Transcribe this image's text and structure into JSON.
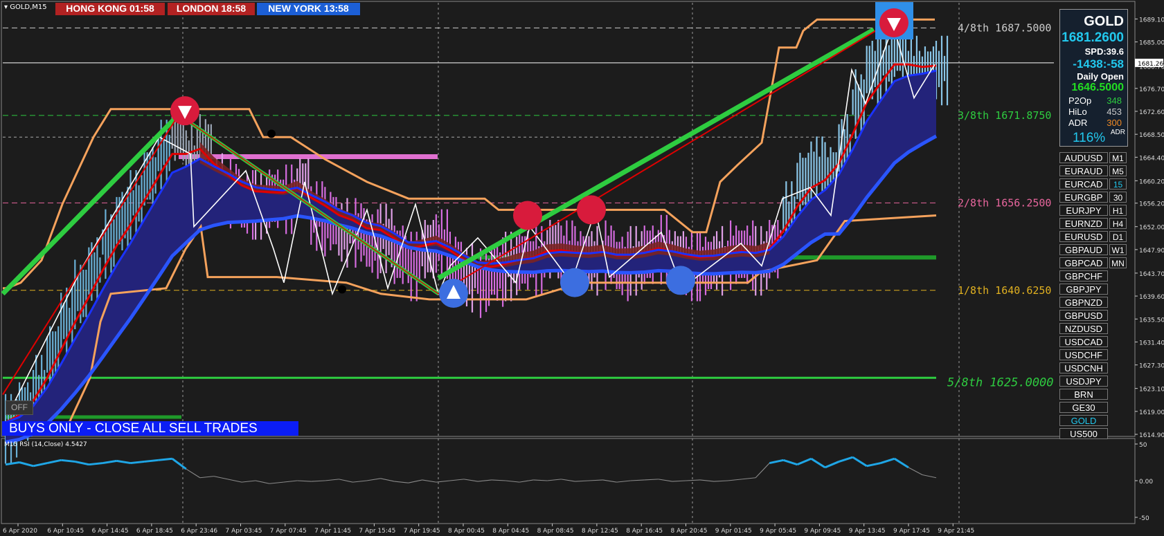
{
  "window": {
    "symbol_label": "GOLD,M15"
  },
  "sessions": [
    {
      "label": "HONG KONG 01:58",
      "bg": "#b22222"
    },
    {
      "label": "LONDON  18:58",
      "bg": "#b22222"
    },
    {
      "label": "NEW YORK  13:58",
      "bg": "#1c5fd6"
    }
  ],
  "colors": {
    "background": "#1c1c1c",
    "envelope": "#f5a25c",
    "ema_blue": "#1a33ff",
    "fill_navy": "#23237a",
    "zigzag": "#ffffff",
    "trend_green": "#2ecc40",
    "trend_red": "#e00000",
    "rsi_blue": "#1fa6e6"
  },
  "murrey_levels": [
    {
      "label": "4/8th",
      "price": "1687.5000",
      "color": "#cccccc"
    },
    {
      "label": "3/8th",
      "price": "1671.8750",
      "color": "#2ecc40"
    },
    {
      "label": "2/8th",
      "price": "1656.2500",
      "color": "#e8669d"
    },
    {
      "label": "1/8th",
      "price": "1640.6250",
      "color": "#e0b020"
    },
    {
      "label": "5/8th",
      "price": "1625.0000",
      "color": "#2ecc40"
    }
  ],
  "buys_banner": "BUYS ONLY - CLOSE ALL SELL TRADES",
  "off_button": "OFF",
  "info_panel": {
    "symbol": "GOLD",
    "price": "1681.2600",
    "spread": "SPD:39.6",
    "timer": "-1438:-58",
    "daily_open_label": "Daily Open",
    "daily_open": "1646.5000",
    "stats": [
      {
        "label": "P2Op",
        "value": "348",
        "color": "#2ecc40"
      },
      {
        "label": "HiLo",
        "value": "453",
        "color": "#cccccc"
      },
      {
        "label": "ADR",
        "value": "300",
        "color": "#f08a24"
      }
    ],
    "adr_pct": "116%",
    "adr_tag": "ADR"
  },
  "symbol_buttons": [
    "AUDUSD",
    "EURAUD",
    "EURCAD",
    "EURGBP",
    "EURJPY",
    "EURNZD",
    "EURUSD",
    "GBPAUD",
    "GBPCAD",
    "GBPCHF",
    "GBPJPY",
    "GBPNZD",
    "GBPUSD",
    "NZDUSD",
    "USDCAD",
    "USDCHF",
    "USDCNH",
    "USDJPY",
    "BRN",
    "GE30",
    "GOLD",
    "US500"
  ],
  "timeframe_buttons": [
    "M1",
    "M5",
    "15",
    "30",
    "H1",
    "H4",
    "D1",
    "W1",
    "MN"
  ],
  "rsi_label": "M15 RSI (14,Close) 4.5427",
  "chart_data": {
    "type": "candlestick",
    "price_axis": {
      "range": [
        1614.9,
        1691.5
      ],
      "ticks": [
        "1689.10",
        "1685.00",
        "1680.70",
        "1676.70",
        "1672.60",
        "1668.50",
        "1664.40",
        "1660.20",
        "1656.20",
        "1652.00",
        "1647.90",
        "1643.70",
        "1639.60",
        "1635.50",
        "1631.40",
        "1627.30",
        "1623.10",
        "1619.00",
        "1614.90"
      ],
      "current_price": "1681.26"
    },
    "time_axis": [
      "6 Apr 2020",
      "6 Apr 10:45",
      "6 Apr 14:45",
      "6 Apr 18:45",
      "6 Apr 23:46",
      "7 Apr 03:45",
      "7 Apr 07:45",
      "7 Apr 11:45",
      "7 Apr 15:45",
      "7 Apr 19:45",
      "8 Apr 00:45",
      "8 Apr 04:45",
      "8 Apr 08:45",
      "8 Apr 12:45",
      "8 Apr 16:45",
      "8 Apr 20:45",
      "9 Apr 01:45",
      "9 Apr 05:45",
      "9 Apr 09:45",
      "9 Apr 13:45",
      "9 Apr 17:45",
      "9 Apr 21:45"
    ],
    "close_series": [
      1617,
      1620,
      1624,
      1630,
      1636,
      1641,
      1645,
      1650,
      1654,
      1657,
      1662,
      1666,
      1670,
      1665,
      1667,
      1660,
      1659,
      1657,
      1657,
      1658,
      1658,
      1660,
      1655,
      1654,
      1652,
      1652,
      1650,
      1651,
      1648,
      1646,
      1649,
      1650,
      1646,
      1644,
      1643,
      1645,
      1646,
      1647,
      1647,
      1649,
      1648,
      1647,
      1647,
      1648,
      1646,
      1647,
      1648,
      1649,
      1647,
      1646,
      1646,
      1647,
      1648,
      1648,
      1647,
      1649,
      1655,
      1661,
      1663,
      1662,
      1667,
      1675,
      1681,
      1682,
      1685,
      1681,
      1680,
      1681
    ],
    "rsi": {
      "levels": [
        "50",
        "0.00",
        "-50"
      ],
      "value": "4.5427",
      "values": [
        22,
        25,
        20,
        24,
        28,
        26,
        22,
        24,
        27,
        24,
        26,
        28,
        30,
        16,
        4,
        6,
        2,
        -2,
        0,
        -4,
        -2,
        0,
        -1,
        0,
        2,
        -2,
        0,
        3,
        -1,
        -3,
        1,
        -2,
        0,
        2,
        -1,
        1,
        0,
        -2,
        1,
        0,
        2,
        -1,
        0,
        1,
        -2,
        0,
        1,
        2,
        -1,
        0,
        1,
        -1,
        0,
        2,
        4,
        24,
        28,
        22,
        30,
        18,
        26,
        32,
        20,
        24,
        30,
        18,
        8,
        4
      ]
    },
    "markers": [
      {
        "type": "sell-arrow",
        "price": 1672.7
      },
      {
        "type": "buy-arrow",
        "price": 1640.1
      },
      {
        "type": "sell-dot",
        "price": 1654.0
      },
      {
        "type": "sell-dot",
        "price": 1655.0
      },
      {
        "type": "buy-dot",
        "price": 1642.0
      },
      {
        "type": "buy-dot",
        "price": 1642.4
      },
      {
        "type": "sell-arrow",
        "price": 1688.7
      }
    ]
  }
}
